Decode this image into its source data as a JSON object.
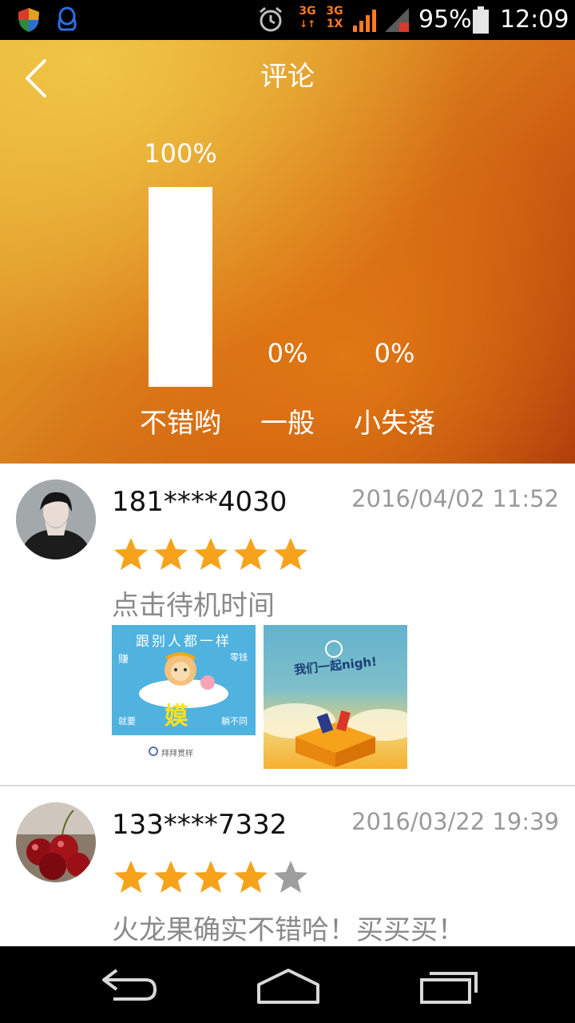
{
  "status_bar": {
    "battery": "95%",
    "time": "12:09",
    "net1": "3G",
    "net2_top": "3G",
    "net2_bottom": "1X",
    "icons": [
      "shield-icon",
      "qq-icon",
      "alarm-icon",
      "signal-icon",
      "battery-icon"
    ]
  },
  "header": {
    "title": "评论",
    "ratings": [
      {
        "label": "不错哟",
        "percent": "100%",
        "value": 100
      },
      {
        "label": "一般",
        "percent": "0%",
        "value": 0
      },
      {
        "label": "小失落",
        "percent": "0%",
        "value": 0
      }
    ]
  },
  "comments": [
    {
      "user": "181****4030",
      "date": "2016/04/02  11:52",
      "stars": 5,
      "text": "点击待机时间",
      "images": [
        {
          "lines": [
            "跟别人都一样",
            "赚",
            "零钱",
            "就要",
            "嫫",
            "躺不同"
          ],
          "footer": "拜拜贯样"
        },
        {
          "lines": [
            "我们一起nigh!"
          ]
        }
      ]
    },
    {
      "user": "133****7332",
      "date": "2016/03/22  19:39",
      "stars": 4,
      "text": "火龙果确实不错哈！买买买！"
    }
  ],
  "colors": {
    "star_on": "#f7a21b",
    "star_off": "#9e9e9e",
    "header_start": "#e8b238",
    "header_end": "#a8360a"
  }
}
